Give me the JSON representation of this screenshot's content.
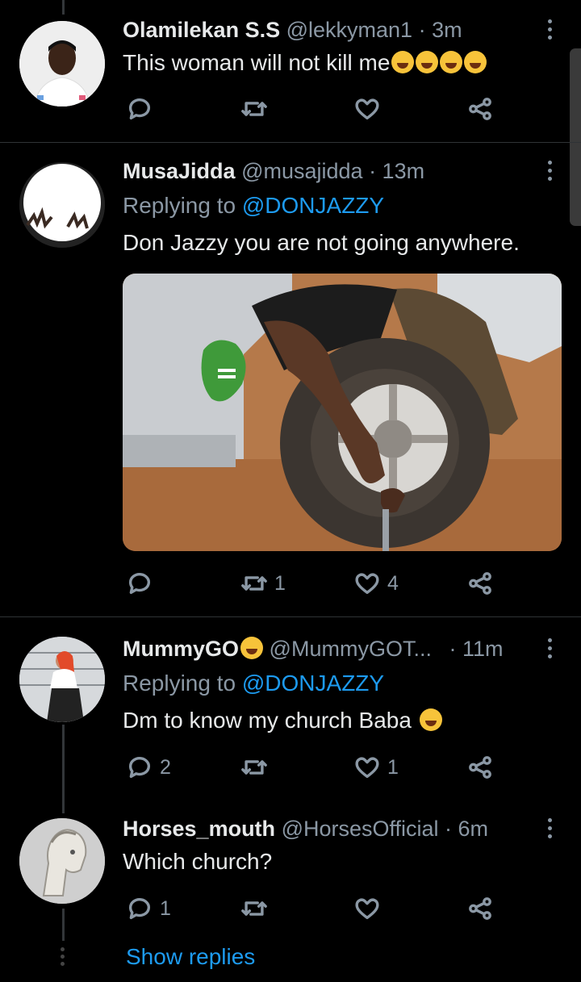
{
  "tweets": [
    {
      "name": "Olamilekan S.S",
      "handle": "@lekkyman1",
      "time": "· 3m",
      "text": "This woman will not kill me",
      "emoji_count": 4,
      "replies": "",
      "retweets": "",
      "likes": ""
    },
    {
      "name": "MusaJidda",
      "handle": "@musajidda",
      "time": "· 13m",
      "replying_prefix": "Replying to",
      "replying_handle": "@DONJAZZY",
      "text": "Don Jazzy you are not going anywhere.",
      "replies": "",
      "retweets": "1",
      "likes": "4"
    },
    {
      "name": "MummyGO",
      "handle": "@MummyGOT...",
      "time": "· 11m",
      "replying_prefix": "Replying to",
      "replying_handle": "@DONJAZZY",
      "text": "Dm to know my church Baba",
      "replies": "2",
      "retweets": "",
      "likes": "1"
    },
    {
      "name": "Horses_mouth",
      "handle": "@HorsesOfficial",
      "time": "· 6m",
      "text": "Which church?",
      "replies": "1",
      "retweets": "",
      "likes": ""
    }
  ],
  "show_replies": "Show replies",
  "colors": {
    "background": "#000000",
    "text": "#e7e9ea",
    "secondary": "#8b98a5",
    "accent": "#1d9bf0"
  },
  "icons": [
    "reply-icon",
    "retweet-icon",
    "like-icon",
    "share-icon",
    "more-icon"
  ]
}
